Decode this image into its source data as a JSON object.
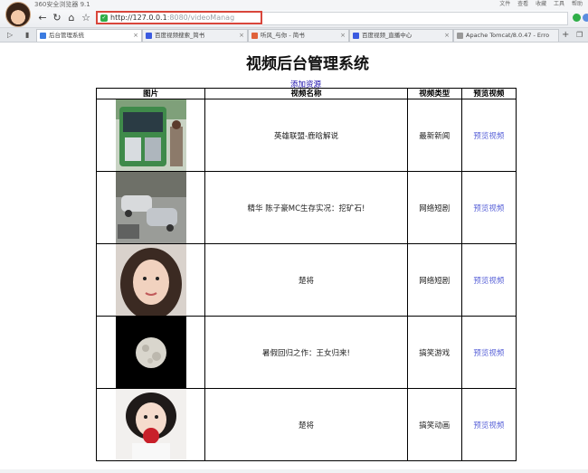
{
  "browser": {
    "name": "360安全浏览器 9.1",
    "menu": [
      "文件",
      "查看",
      "收藏",
      "工具",
      "帮助"
    ],
    "url_host": "http://127.0.0.1",
    "url_path": ":8080/videoManag"
  },
  "tabs": [
    {
      "label": "后台管理系统",
      "active": true,
      "color": "#3b7be0"
    },
    {
      "label": "百度视频搜索_简书",
      "active": false,
      "color": "#3b5be0"
    },
    {
      "label": "听风_与你 - 简书",
      "active": false,
      "color": "#e0623b"
    },
    {
      "label": "百度视频_直播中心",
      "active": false,
      "color": "#3b5be0"
    },
    {
      "label": "Apache Tomcat/8.0.47 - Erro",
      "active": false,
      "color": "#999999"
    }
  ],
  "page": {
    "title": "视频后台管理系统",
    "add_link": "添加资源"
  },
  "table": {
    "headers": [
      "图片",
      "视频名称",
      "视频类型",
      "预览视频"
    ],
    "rows": [
      {
        "name": "英雄联盟-鹿晗解说",
        "type": "最新新闻",
        "preview": "预览视频",
        "image": "bus-photo"
      },
      {
        "name": "精华 陈子豪MC生存实况：挖矿石!",
        "type": "网络短剧",
        "preview": "预览视频",
        "image": "street-crash-photo"
      },
      {
        "name": "楚将",
        "type": "网络短剧",
        "preview": "预览视频",
        "image": "girl-portrait-photo"
      },
      {
        "name": "暑假回归之作：王女归来!",
        "type": "搞笑游戏",
        "preview": "预览视频",
        "image": "moon-photo"
      },
      {
        "name": "楚将",
        "type": "搞笑动画",
        "preview": "预览视频",
        "image": "girl-apple-photo"
      }
    ]
  }
}
